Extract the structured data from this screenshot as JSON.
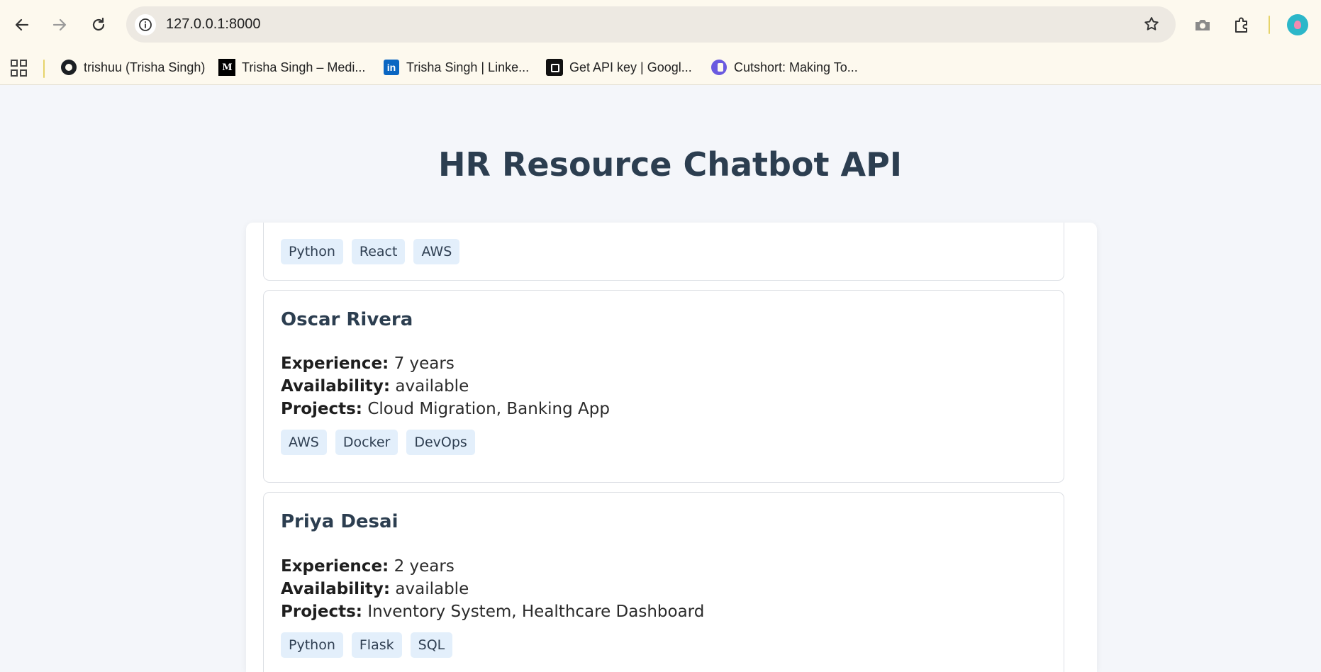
{
  "browser": {
    "url": "127.0.0.1:8000",
    "bookmarks": [
      {
        "label": "trishuu (Trisha Singh)",
        "icon": "github-icon"
      },
      {
        "label": "Trisha Singh – Medi...",
        "icon": "medium-icon"
      },
      {
        "label": "Trisha Singh | Linke...",
        "icon": "linkedin-icon"
      },
      {
        "label": "Get API key | Googl...",
        "icon": "ai-studio-icon"
      },
      {
        "label": "Cutshort: Making To...",
        "icon": "cutshort-icon"
      }
    ],
    "favicon_text": {
      "medium": "M",
      "linkedin": "in"
    }
  },
  "page": {
    "title": "HR Resource Chatbot API"
  },
  "labels": {
    "experience": "Experience:",
    "availability": "Availability:",
    "projects": "Projects:"
  },
  "candidates": [
    {
      "name": "",
      "skills": [
        "Python",
        "React",
        "AWS"
      ]
    },
    {
      "name": "Oscar Rivera",
      "experience": "7 years",
      "availability": "available",
      "projects": "Cloud Migration, Banking App",
      "skills": [
        "AWS",
        "Docker",
        "DevOps"
      ]
    },
    {
      "name": "Priya Desai",
      "experience": "2 years",
      "availability": "available",
      "projects": "Inventory System, Healthcare Dashboard",
      "skills": [
        "Python",
        "Flask",
        "SQL"
      ]
    }
  ],
  "colors": {
    "title": "#2c3e50",
    "tag_bg": "#e3effb",
    "page_bg": "#f4f6fa",
    "chrome_bg": "#fdf9ee"
  }
}
